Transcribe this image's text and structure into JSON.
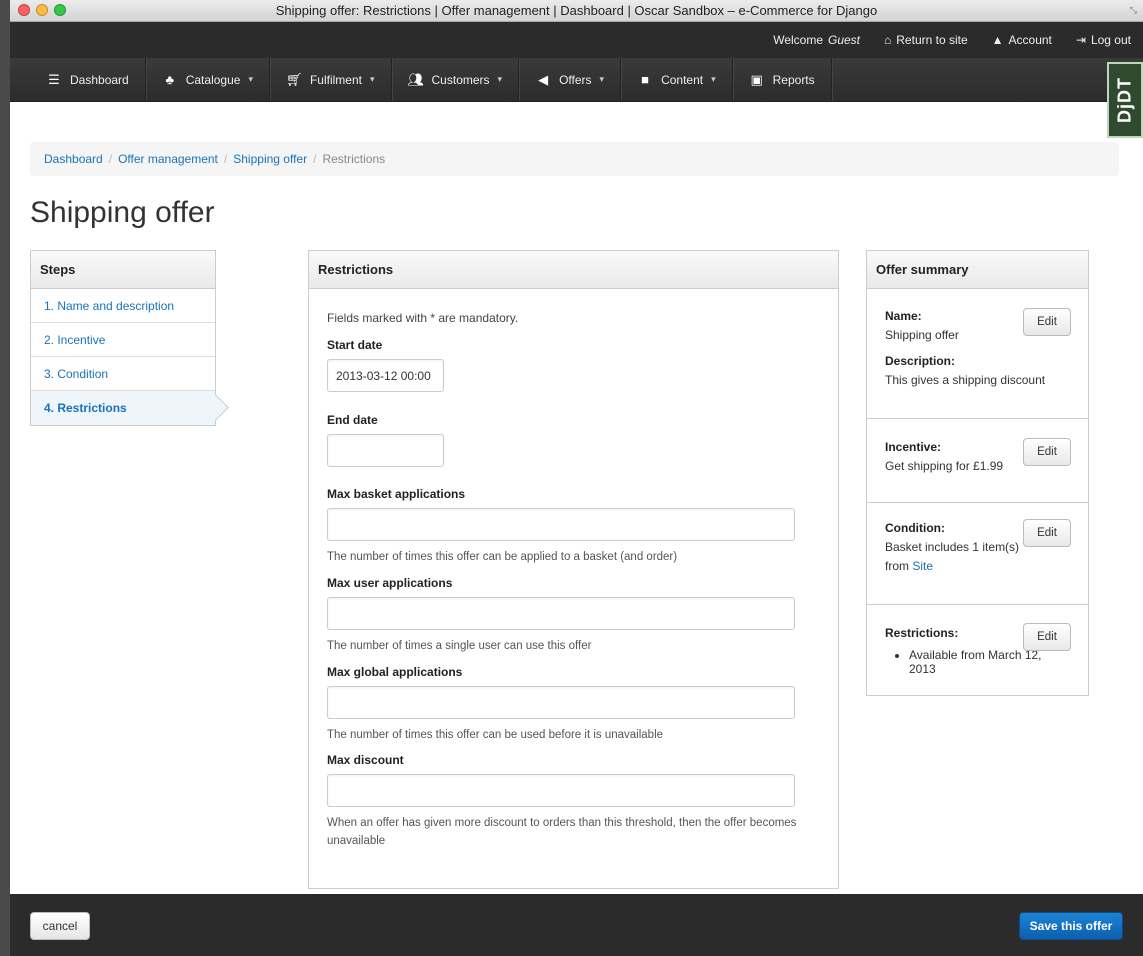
{
  "window": {
    "title": "Shipping offer: Restrictions | Offer management | Dashboard | Oscar Sandbox – e-Commerce for Django"
  },
  "userbar": {
    "welcome": "Welcome",
    "user": "Guest",
    "return_to_site": "Return to site",
    "account": "Account",
    "logout": "Log out"
  },
  "nav": {
    "items": [
      {
        "label": "Dashboard",
        "icon": "dashboard-icon",
        "dropdown": false
      },
      {
        "label": "Catalogue",
        "icon": "sitemap-icon",
        "dropdown": true
      },
      {
        "label": "Fulfilment",
        "icon": "cart-icon",
        "dropdown": true
      },
      {
        "label": "Customers",
        "icon": "group-icon",
        "dropdown": true
      },
      {
        "label": "Offers",
        "icon": "bullhorn-icon",
        "dropdown": true
      },
      {
        "label": "Content",
        "icon": "folder-icon",
        "dropdown": true
      },
      {
        "label": "Reports",
        "icon": "bar-chart-icon",
        "dropdown": false
      }
    ],
    "debug_toolbar": "DjDT"
  },
  "breadcrumb": {
    "items": [
      "Dashboard",
      "Offer management",
      "Shipping offer"
    ],
    "active": "Restrictions"
  },
  "page_title": "Shipping offer",
  "steps": {
    "heading": "Steps",
    "items": [
      "1. Name and description",
      "2. Incentive",
      "3. Condition",
      "4. Restrictions"
    ]
  },
  "form": {
    "heading": "Restrictions",
    "mandatory_note": "Fields marked with * are mandatory.",
    "start_date": {
      "label": "Start date",
      "value": "2013-03-12 00:00"
    },
    "end_date": {
      "label": "End date",
      "value": ""
    },
    "max_basket": {
      "label": "Max basket applications",
      "value": "",
      "help": "The number of times this offer can be applied to a basket (and order)"
    },
    "max_user": {
      "label": "Max user applications",
      "value": "",
      "help": "The number of times a single user can use this offer"
    },
    "max_global": {
      "label": "Max global applications",
      "value": "",
      "help": "The number of times this offer can be used before it is unavailable"
    },
    "max_discount": {
      "label": "Max discount",
      "value": "",
      "help": "When an offer has given more discount to orders than this threshold, then the offer becomes unavailable"
    }
  },
  "summary": {
    "heading": "Offer summary",
    "edit_label": "Edit",
    "name_label": "Name:",
    "name_value": "Shipping offer",
    "description_label": "Description:",
    "description_value": "This gives a shipping discount",
    "incentive_label": "Incentive:",
    "incentive_value": "Get shipping for £1.99",
    "condition_label": "Condition:",
    "condition_value": "Basket includes 1 item(s) from",
    "condition_link": "Site",
    "restrictions_label": "Restrictions:",
    "restrictions_items": [
      "Available from March 12, 2013"
    ]
  },
  "footer": {
    "cancel": "cancel",
    "save": "Save this offer"
  }
}
